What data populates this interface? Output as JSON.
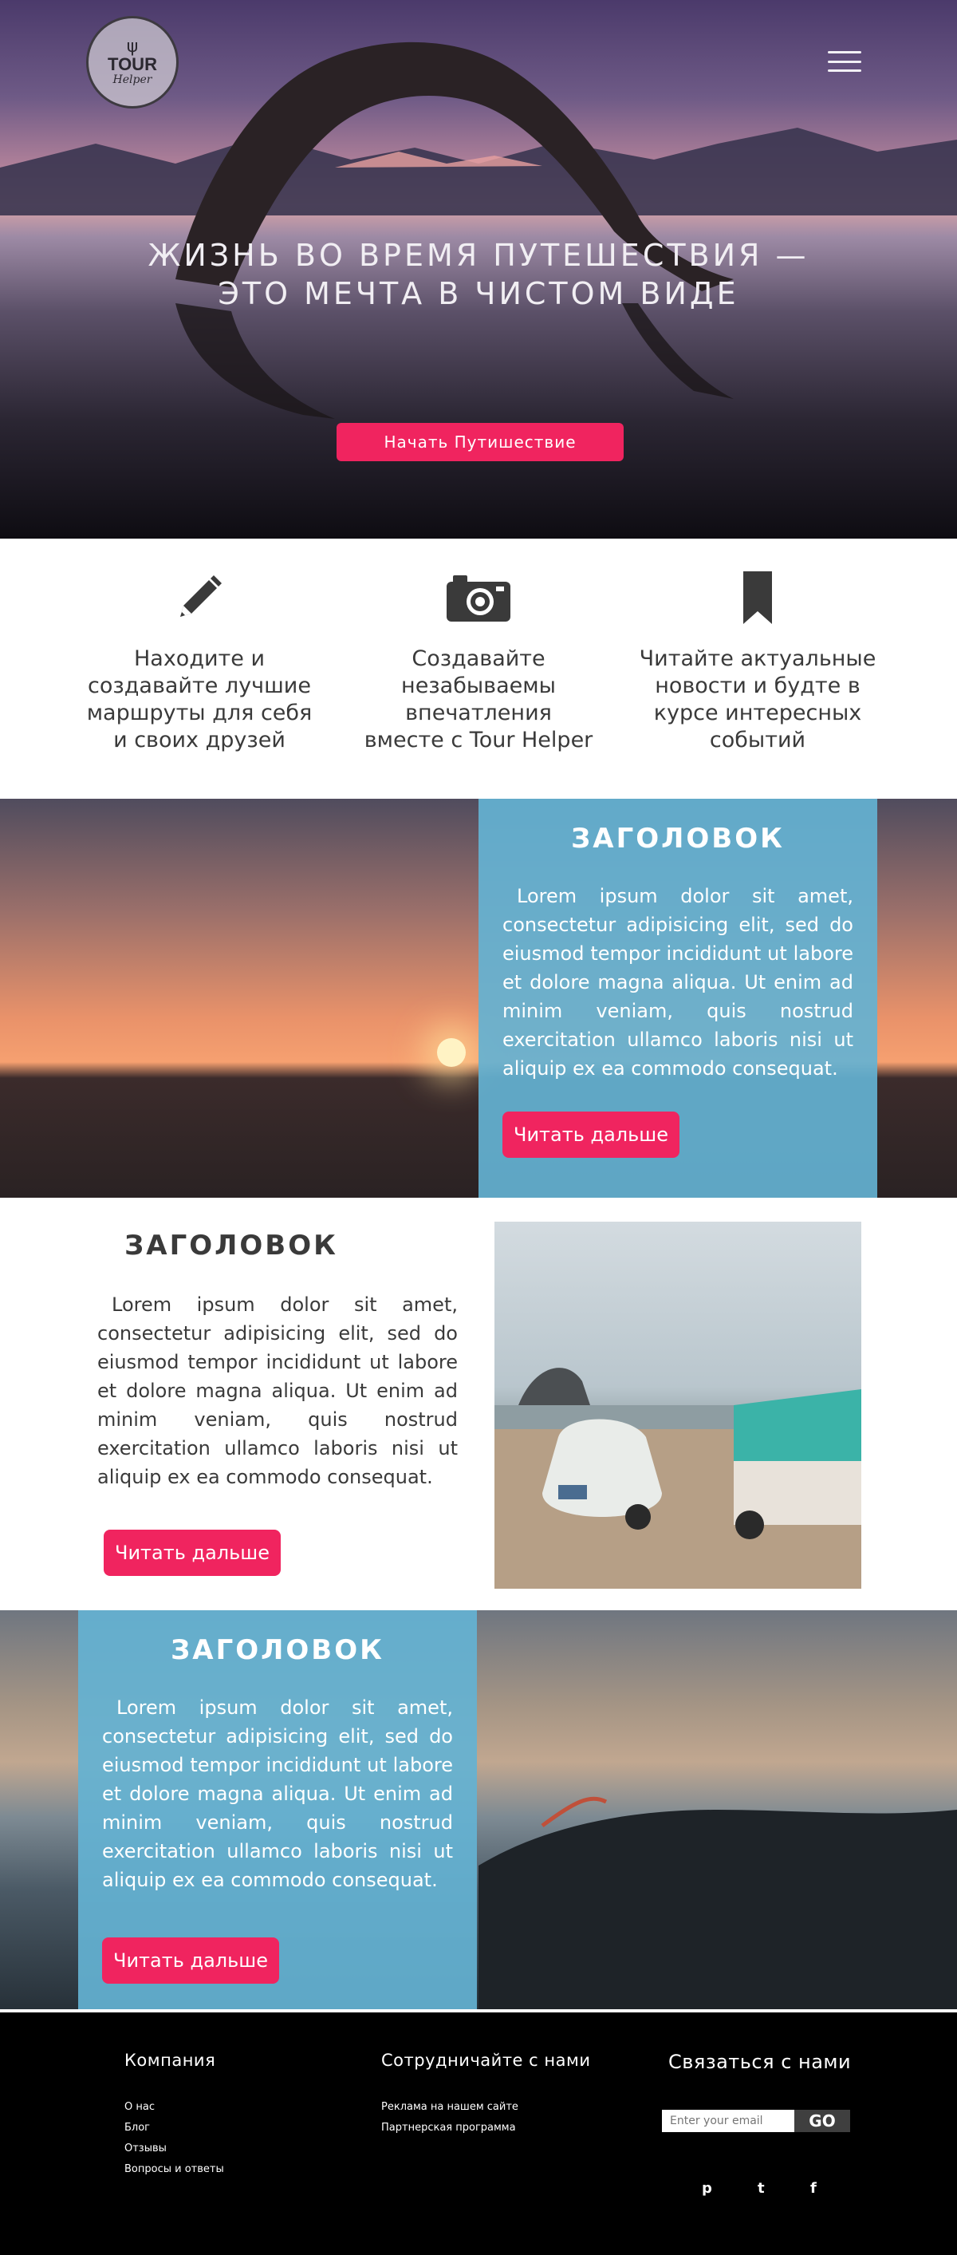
{
  "logo": {
    "line1": "TOUR",
    "line2": "Helper",
    "antler": "ψ"
  },
  "hero": {
    "title_line1": "ЖИЗНЬ ВО ВРЕМЯ ПУТЕШЕСТВИЯ —",
    "title_line2": "ЭТО МЕЧТА В ЧИСТОМ ВИДЕ",
    "cta": "Начать Путишествие"
  },
  "features": [
    {
      "icon": "pencil-icon",
      "line1": "Находите и",
      "line2": "создавайте лучшие",
      "line3": "маршруты для себя",
      "line4": "и своих друзей"
    },
    {
      "icon": "camera-icon",
      "line1": "Создавайте",
      "line2": "незабываемы",
      "line3": "впечатления",
      "line4": "вместе с Tour Helper"
    },
    {
      "icon": "bookmark-icon",
      "line1": "Читайте актуальные",
      "line2": "новости и будте в",
      "line3": "курсе интересных",
      "line4": "событий"
    }
  ],
  "sections": [
    {
      "heading": "ЗАГОЛОВОК",
      "body": "Lorem ipsum dolor sit amet, consectetur adipisicing elit, sed do eiusmod tempor incididunt ut labore et dolore magna aliqua. Ut enim ad minim veniam, quis nostrud exercitation ullamco laboris nisi ut aliquip ex ea commodo consequat.",
      "button": "Читать дальше"
    },
    {
      "heading": "ЗАГОЛОВОК",
      "body": "Lorem ipsum dolor sit amet, consectetur adipisicing elit, sed do eiusmod tempor incididunt ut labore et dolore magna aliqua. Ut enim ad minim veniam, quis nostrud exercitation ullamco laboris nisi ut aliquip ex ea commodo consequat.",
      "button": "Читать дальше"
    },
    {
      "heading": "ЗАГОЛОВОК",
      "body": "Lorem ipsum dolor sit amet, consectetur adipisicing elit, sed do eiusmod tempor incididunt ut labore et dolore magna aliqua. Ut enim ad minim veniam, quis nostrud exercitation ullamco laboris nisi ut aliquip ex ea commodo consequat.",
      "button": "Читать дальше"
    }
  ],
  "footer": {
    "company": {
      "title": "Компания",
      "links": [
        "О нас",
        "Блог",
        "Отзывы",
        "Вопросы и ответы"
      ]
    },
    "partners": {
      "title": "Сотрудничайте с нами",
      "links": [
        "Реклама на нашем сайте",
        "Партнерская программа"
      ]
    },
    "contact": {
      "title": "Связаться с нами",
      "placeholder": "Enter your email",
      "button": "GO"
    },
    "social": [
      {
        "icon": "pinterest-icon",
        "glyph": "p"
      },
      {
        "icon": "twitter-icon",
        "glyph": "t"
      },
      {
        "icon": "facebook-icon",
        "glyph": "f"
      }
    ]
  },
  "colors": {
    "accent": "#f0245f",
    "panel": "#64b2d2",
    "footer": "#000000"
  }
}
